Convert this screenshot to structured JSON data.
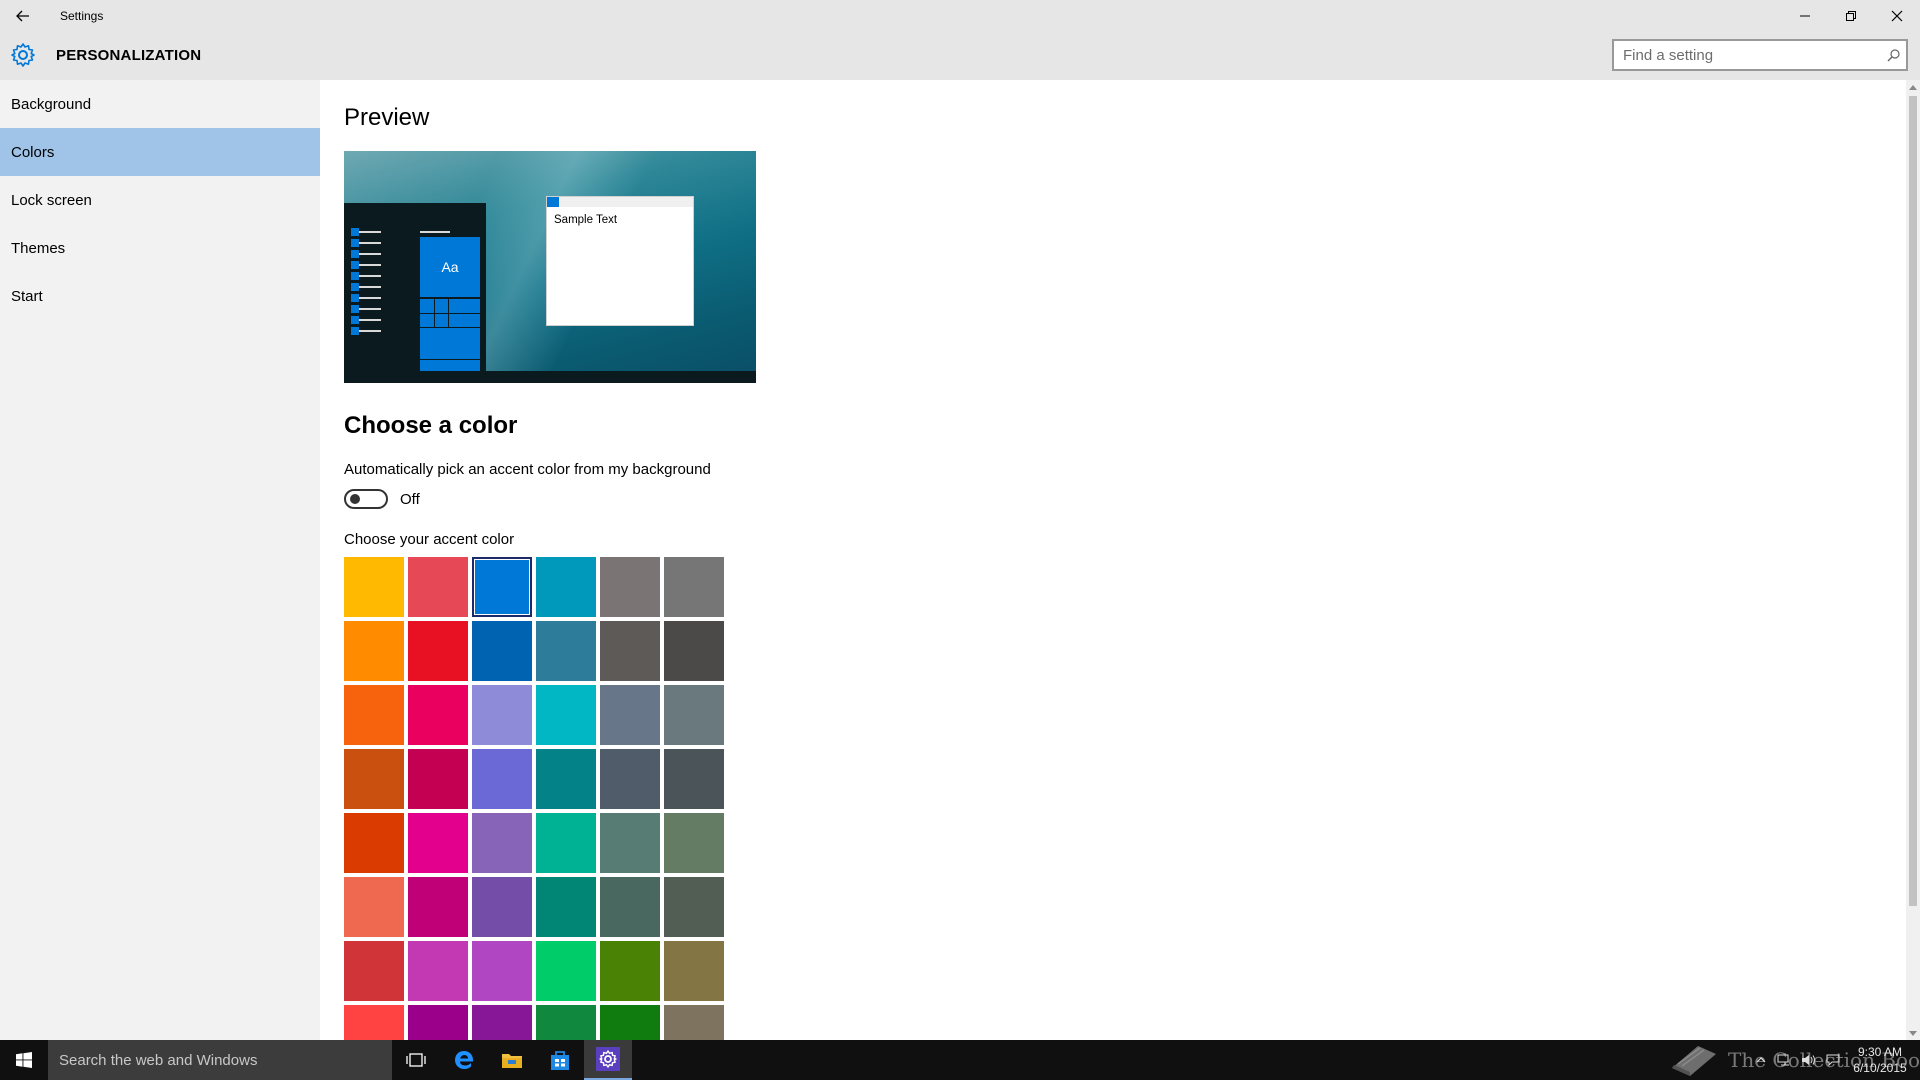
{
  "window": {
    "title": "Settings",
    "controls": [
      "minimize",
      "restore",
      "close"
    ]
  },
  "header": {
    "section_title": "PERSONALIZATION",
    "search_placeholder": "Find a setting"
  },
  "sidebar": {
    "items": [
      {
        "label": "Background",
        "selected": false
      },
      {
        "label": "Colors",
        "selected": true
      },
      {
        "label": "Lock screen",
        "selected": false
      },
      {
        "label": "Themes",
        "selected": false
      },
      {
        "label": "Start",
        "selected": false
      }
    ]
  },
  "main": {
    "preview_heading": "Preview",
    "preview_tile_text": "Aa",
    "preview_sample_text": "Sample Text",
    "choose_heading": "Choose a color",
    "auto_pick_label": "Automatically pick an accent color from my background",
    "toggle_state": "Off",
    "accent_label": "Choose your accent color",
    "selected_accent": "#0078d7",
    "accent_colors": [
      [
        "#ffb900",
        "#e74856",
        "#0078d7",
        "#0099bc",
        "#7a7574",
        "#767676"
      ],
      [
        "#ff8c00",
        "#e81123",
        "#0063b1",
        "#2d7d9a",
        "#5d5a58",
        "#4c4a48"
      ],
      [
        "#f7630c",
        "#ea005e",
        "#8e8cd8",
        "#00b7c3",
        "#68768a",
        "#69797e"
      ],
      [
        "#ca5010",
        "#c30052",
        "#6b69d6",
        "#038387",
        "#515c6b",
        "#4a5459"
      ],
      [
        "#da3b01",
        "#e3008c",
        "#8764b8",
        "#00b294",
        "#567c73",
        "#647c64"
      ],
      [
        "#ef6950",
        "#bf0077",
        "#744da9",
        "#018574",
        "#486860",
        "#525e54"
      ],
      [
        "#d13438",
        "#c239b3",
        "#b146c2",
        "#00cc6a",
        "#498205",
        "#847545"
      ],
      [
        "#ff4343",
        "#9a0089",
        "#881798",
        "#10893e",
        "#107c10",
        "#7e735f"
      ]
    ]
  },
  "taskbar": {
    "search_placeholder": "Search the web and Windows",
    "apps": [
      "task-view",
      "edge",
      "file-explorer",
      "store",
      "settings"
    ],
    "watermark_text": "The Collection Book",
    "time": "9:30 AM",
    "date": "6/10/2015"
  }
}
